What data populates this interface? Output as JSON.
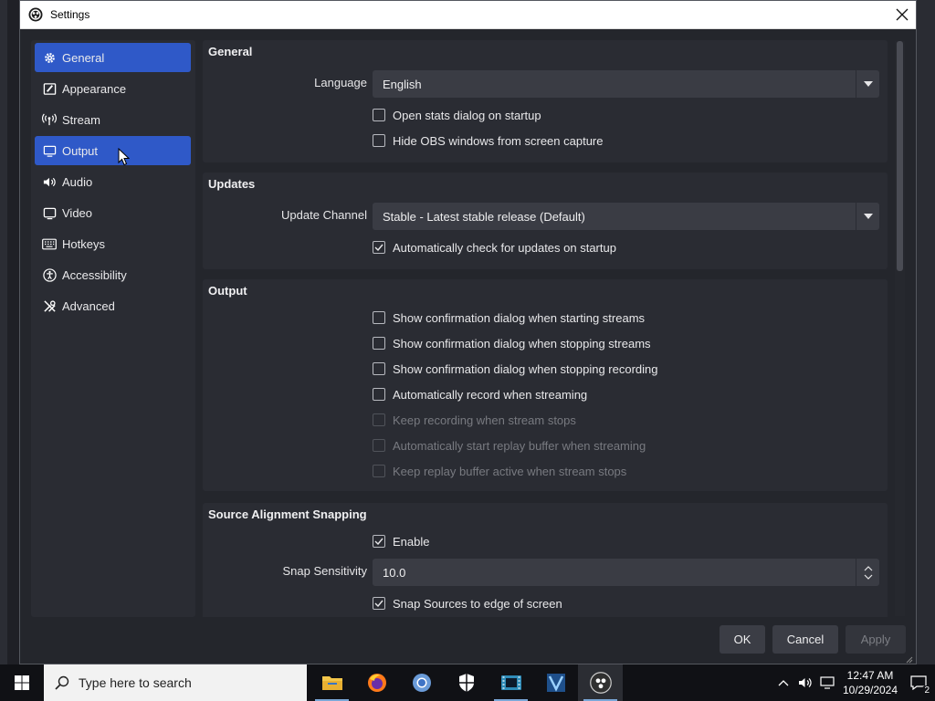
{
  "window": {
    "title": "Settings"
  },
  "sidebar": {
    "items": [
      {
        "label": "General",
        "icon": "gear-icon",
        "active": true
      },
      {
        "label": "Appearance",
        "icon": "brush-icon",
        "active": false
      },
      {
        "label": "Stream",
        "icon": "antenna-icon",
        "active": false
      },
      {
        "label": "Output",
        "icon": "monitor-output-icon",
        "active": true
      },
      {
        "label": "Audio",
        "icon": "speaker-icon",
        "active": false
      },
      {
        "label": "Video",
        "icon": "display-icon",
        "active": false
      },
      {
        "label": "Hotkeys",
        "icon": "keyboard-icon",
        "active": false
      },
      {
        "label": "Accessibility",
        "icon": "accessibility-icon",
        "active": false
      },
      {
        "label": "Advanced",
        "icon": "tools-icon",
        "active": false
      }
    ]
  },
  "general": {
    "title": "General",
    "language_label": "Language",
    "language_value": "English",
    "open_stats": "Open stats dialog on startup",
    "hide_obs": "Hide OBS windows from screen capture"
  },
  "updates": {
    "title": "Updates",
    "channel_label": "Update Channel",
    "channel_value": "Stable - Latest stable release (Default)",
    "auto_check": "Automatically check for updates on startup"
  },
  "output": {
    "title": "Output",
    "options": [
      {
        "label": "Show confirmation dialog when starting streams",
        "checked": false,
        "disabled": false
      },
      {
        "label": "Show confirmation dialog when stopping streams",
        "checked": false,
        "disabled": false
      },
      {
        "label": "Show confirmation dialog when stopping recording",
        "checked": false,
        "disabled": false
      },
      {
        "label": "Automatically record when streaming",
        "checked": false,
        "disabled": false
      },
      {
        "label": "Keep recording when stream stops",
        "checked": false,
        "disabled": true
      },
      {
        "label": "Automatically start replay buffer when streaming",
        "checked": false,
        "disabled": true
      },
      {
        "label": "Keep replay buffer active when stream stops",
        "checked": false,
        "disabled": true
      }
    ]
  },
  "snapping": {
    "title": "Source Alignment Snapping",
    "enable_label": "Enable",
    "sensitivity_label": "Snap Sensitivity",
    "sensitivity_value": "10.0",
    "snap_edge": "Snap Sources to edge of screen"
  },
  "buttons": {
    "ok": "OK",
    "cancel": "Cancel",
    "apply": "Apply"
  },
  "taskbar": {
    "search_placeholder": "Type here to search",
    "time": "12:47 AM",
    "date": "10/29/2024",
    "notification_count": "2"
  },
  "colors": {
    "accent": "#2f59c8",
    "panel": "#2a2c33",
    "window": "#24262c"
  }
}
